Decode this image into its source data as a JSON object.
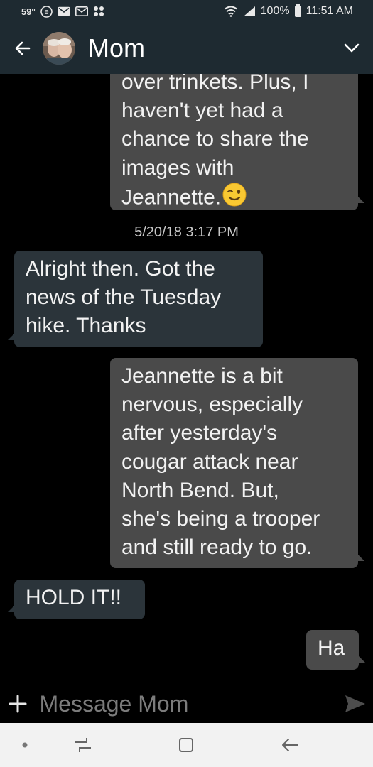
{
  "status_bar": {
    "temperature": "59°",
    "battery": "100%",
    "time": "11:51 AM",
    "icons": [
      "weather-temp",
      "e-app-icon",
      "mail-icon",
      "mail-icon",
      "dots-app-icon",
      "wifi-icon",
      "signal-icon",
      "battery-icon"
    ]
  },
  "header": {
    "contact_name": "Mom",
    "icons": [
      "back-arrow-icon",
      "avatar",
      "chevron-down-icon"
    ]
  },
  "messages": [
    {
      "direction": "outgoing",
      "lines": [
        "over trinkets. Plus, I",
        "haven't yet had a",
        "chance to share the",
        "images with",
        "Jeannette."
      ],
      "emoji": "winking-face"
    },
    {
      "type": "timestamp",
      "text": "5/20/18 3:17 PM"
    },
    {
      "direction": "incoming",
      "lines": [
        "Alright then. Got the",
        "news of the Tuesday",
        "hike. Thanks"
      ]
    },
    {
      "direction": "outgoing",
      "lines": [
        "Jeannette is a bit",
        "nervous, especially",
        "after yesterday's",
        "cougar attack near",
        "North Bend. But,",
        "she's being a trooper",
        "and still ready to go."
      ]
    },
    {
      "direction": "incoming",
      "lines": [
        "HOLD IT!!"
      ]
    },
    {
      "direction": "outgoing",
      "lines": [
        "Ha"
      ]
    }
  ],
  "composer": {
    "placeholder": "Message Mom",
    "value": ""
  },
  "colors": {
    "header_bg": "#1e2a31",
    "outgoing_bubble": "#4a4a4a",
    "incoming_bubble": "#2b343a",
    "background": "#000000",
    "nav_bar_bg": "#f2f2f2"
  }
}
